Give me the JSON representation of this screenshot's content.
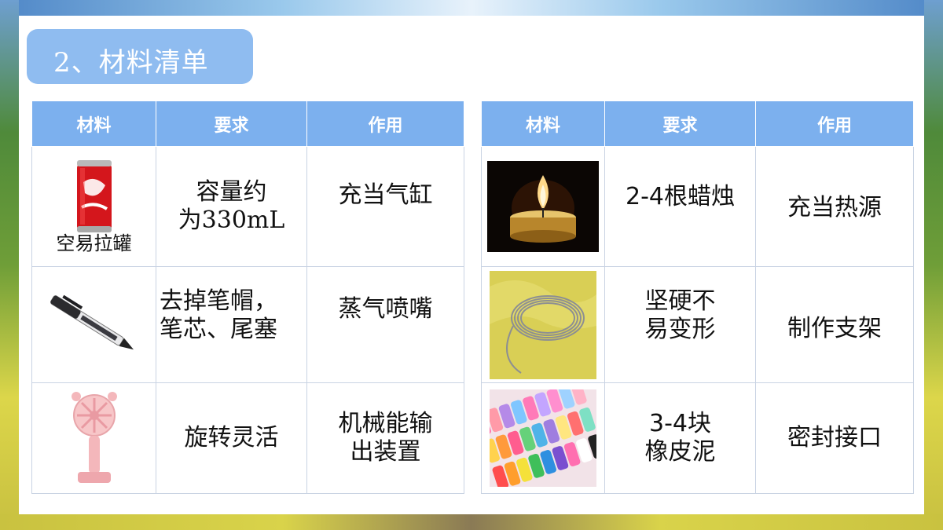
{
  "title": "2、材料清单",
  "headers": {
    "material": "材料",
    "requirement": "要求",
    "purpose": "作用"
  },
  "left_table": {
    "rows": [
      {
        "material_label": "空易拉罐",
        "material_icon": "soda-can-icon",
        "requirement_line1": "容量约",
        "requirement_line2": "为330mL",
        "purpose": "充当气缸"
      },
      {
        "material_icon": "gel-pen-icon",
        "requirement_line1": "去掉笔帽，",
        "requirement_line2": "笔芯、尾塞",
        "purpose": "蒸气喷嘴"
      },
      {
        "material_icon": "handheld-fan-icon",
        "requirement": "旋转灵活",
        "purpose_line1": "机械能输",
        "purpose_line2": "出装置"
      }
    ]
  },
  "right_table": {
    "rows": [
      {
        "material_icon": "candle-icon",
        "requirement": "2-4根蜡烛",
        "purpose": "充当热源"
      },
      {
        "material_icon": "wire-coil-icon",
        "requirement_line1": "坚硬不",
        "requirement_line2": "易变形",
        "purpose": "制作支架"
      },
      {
        "material_icon": "clay-sticks-icon",
        "requirement_line1": "3-4块",
        "requirement_line2": "橡皮泥",
        "purpose": "密封接口"
      }
    ]
  },
  "colors": {
    "title_bg": "#8fbcf0",
    "header_bg": "#7cb0ee",
    "header_text": "#ffffff",
    "grid_border": "#c9d3e3"
  }
}
